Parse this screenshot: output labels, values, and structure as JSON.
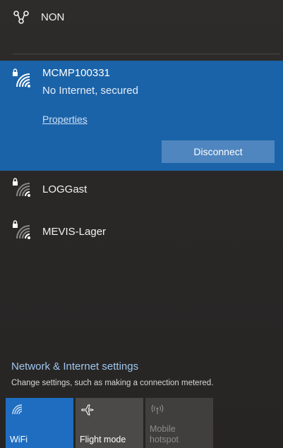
{
  "networks": {
    "top": {
      "name": "NON"
    },
    "connected": {
      "name": "MCMP100331",
      "status": "No Internet, secured",
      "properties_link": "Properties",
      "disconnect_label": "Disconnect"
    },
    "others": [
      {
        "name": "LOGGast"
      },
      {
        "name": "MEVIS-Lager"
      }
    ]
  },
  "settings": {
    "title": "Network & Internet settings",
    "subtitle": "Change settings, such as making a connection metered."
  },
  "quick_actions": [
    {
      "label": "WiFi",
      "icon": "wifi-icon",
      "state": "on"
    },
    {
      "label": "Flight mode",
      "icon": "airplane-icon",
      "state": "off"
    },
    {
      "label": "Mobile hotspot",
      "icon": "hotspot-icon",
      "state": "disabled"
    }
  ],
  "colors": {
    "accent": "#1b63a8",
    "accent_button": "#4f86bf",
    "link": "#9fc7ef",
    "background": "#2b2b2b"
  }
}
